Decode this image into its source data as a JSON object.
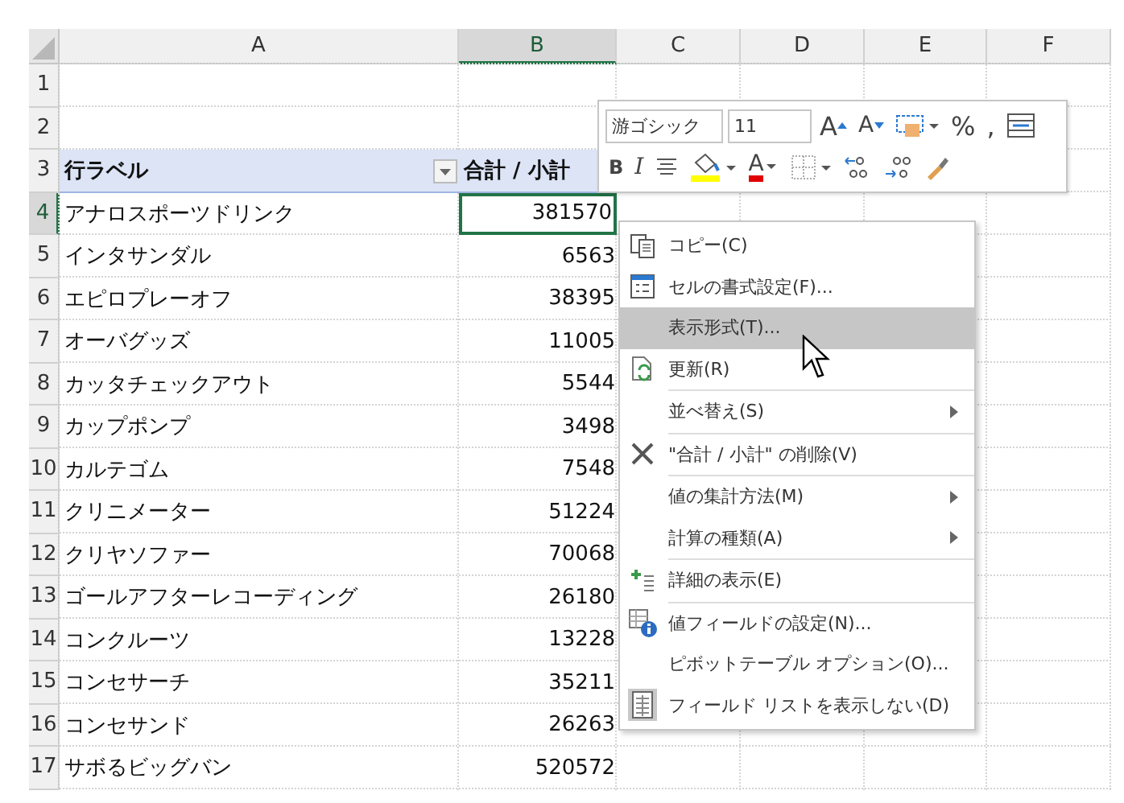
{
  "columns": [
    {
      "label": "A",
      "selected": false
    },
    {
      "label": "B",
      "selected": true
    },
    {
      "label": "C",
      "selected": false
    },
    {
      "label": "D",
      "selected": false
    },
    {
      "label": "E",
      "selected": false
    },
    {
      "label": "F",
      "selected": false
    }
  ],
  "rows": [
    {
      "number": "1",
      "kind": "blank",
      "selected": false
    },
    {
      "number": "2",
      "kind": "blank",
      "selected": false
    },
    {
      "number": "3",
      "kind": "header",
      "selected": false,
      "label": "行ラベル",
      "value": "合計 / 小計"
    },
    {
      "number": "4",
      "kind": "data",
      "selected": true,
      "label": "アナロスポーツドリンク",
      "value": "381570"
    },
    {
      "number": "5",
      "kind": "data",
      "selected": false,
      "label": "インタサンダル",
      "value": "6563"
    },
    {
      "number": "6",
      "kind": "data",
      "selected": false,
      "label": "エピロプレーオフ",
      "value": "38395"
    },
    {
      "number": "7",
      "kind": "data",
      "selected": false,
      "label": "オーバグッズ",
      "value": "11005"
    },
    {
      "number": "8",
      "kind": "data",
      "selected": false,
      "label": "カッタチェックアウト",
      "value": "5544"
    },
    {
      "number": "9",
      "kind": "data",
      "selected": false,
      "label": "カップポンプ",
      "value": "3498"
    },
    {
      "number": "10",
      "kind": "data",
      "selected": false,
      "label": "カルテゴム",
      "value": "7548"
    },
    {
      "number": "11",
      "kind": "data",
      "selected": false,
      "label": "クリニメーター",
      "value": "51224"
    },
    {
      "number": "12",
      "kind": "data",
      "selected": false,
      "label": "クリヤソファー",
      "value": "70068"
    },
    {
      "number": "13",
      "kind": "data",
      "selected": false,
      "label": "ゴールアフターレコーディング",
      "value": "26180"
    },
    {
      "number": "14",
      "kind": "data",
      "selected": false,
      "label": "コンクルーツ",
      "value": "13228"
    },
    {
      "number": "15",
      "kind": "data",
      "selected": false,
      "label": "コンセサーチ",
      "value": "35211"
    },
    {
      "number": "16",
      "kind": "data",
      "selected": false,
      "label": "コンセサンド",
      "value": "26263"
    },
    {
      "number": "17",
      "kind": "data",
      "selected": false,
      "label": "サボるビッグバン",
      "value": "520572"
    }
  ],
  "mini_toolbar": {
    "font": "游ゴシック",
    "size": "11",
    "row_1": [
      {
        "kind": "grow",
        "label": "A"
      },
      {
        "kind": "shrink",
        "label": "A"
      },
      {
        "kind": "styles"
      },
      {
        "kind": "text",
        "label": "%"
      },
      {
        "kind": "text",
        "label": ","
      },
      {
        "kind": "merge"
      }
    ],
    "row_2": [
      {
        "kind": "bold",
        "label": "B"
      },
      {
        "kind": "italic",
        "label": "I"
      },
      {
        "kind": "align"
      },
      {
        "kind": "fill"
      },
      {
        "kind": "fontcolor",
        "label": "A"
      },
      {
        "kind": "border"
      },
      {
        "kind": "inc-decimal"
      },
      {
        "kind": "dec-decimal"
      },
      {
        "kind": "brush"
      }
    ]
  },
  "context_menu": [
    {
      "kind": "copy",
      "label": "コピー(C)",
      "selected": false
    },
    {
      "kind": "format",
      "label": "セルの書式設定(F)...",
      "selected": false
    },
    {
      "kind": "plain",
      "label": "表示形式(T)...",
      "selected": true
    },
    {
      "kind": "refresh",
      "label": "更新(R)",
      "selected": false
    },
    {
      "kind": "plain",
      "label": "並べ替え(S)",
      "selected": false,
      "submenu": true,
      "divider_above": true
    },
    {
      "kind": "remove",
      "label": "\"合計 / 小計\" の削除(V)",
      "selected": false,
      "divider_above": true
    },
    {
      "kind": "plain",
      "label": "値の集計方法(M)",
      "selected": false,
      "submenu": true,
      "divider_above": true
    },
    {
      "kind": "plain",
      "label": "計算の種類(A)",
      "selected": false,
      "submenu": true
    },
    {
      "kind": "expand",
      "label": "詳細の表示(E)",
      "selected": false,
      "divider_above": true
    },
    {
      "kind": "settings",
      "label": "値フィールドの設定(N)...",
      "selected": false,
      "divider_above": true
    },
    {
      "kind": "plain",
      "label": "ピボットテーブル オプション(O)...",
      "selected": false
    },
    {
      "kind": "list",
      "label": "フィールド リストを表示しない(D)",
      "selected": false
    }
  ]
}
